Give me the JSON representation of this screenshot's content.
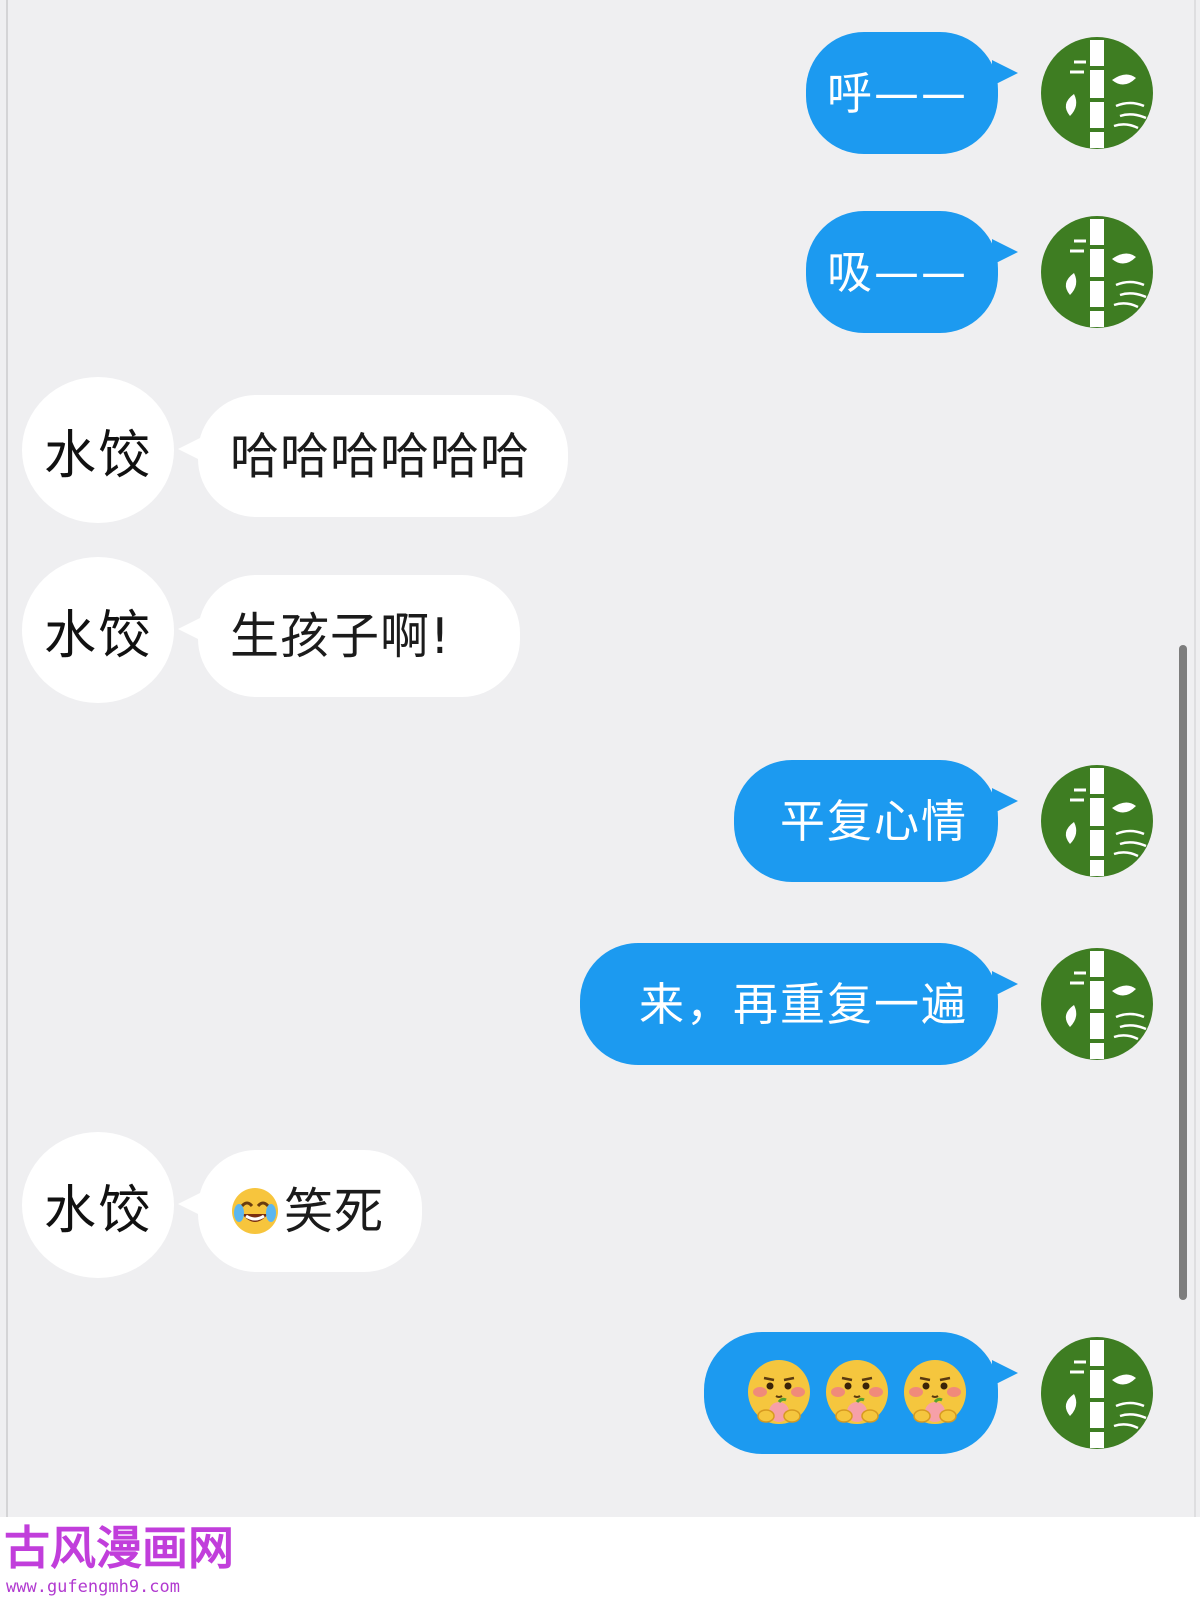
{
  "messages": [
    {
      "side": "sent",
      "text": "呼——"
    },
    {
      "side": "sent",
      "text": "吸——"
    },
    {
      "side": "received",
      "sender": "水饺",
      "text": "哈哈哈哈哈哈"
    },
    {
      "side": "received",
      "sender": "水饺",
      "text": "生孩子啊!"
    },
    {
      "side": "sent",
      "text": "平复心情"
    },
    {
      "side": "sent",
      "text": "来，再重复一遍"
    },
    {
      "side": "received",
      "sender": "水饺",
      "emoji": "tears-of-joy-icon",
      "text": "笑死"
    },
    {
      "side": "sent",
      "emoji": [
        "peach-holding-emoji",
        "peach-holding-emoji",
        "peach-holding-emoji"
      ]
    }
  ],
  "contact": {
    "name": "水饺"
  },
  "watermark": {
    "title": "古风漫画网",
    "url": "www.gufengmh9.com"
  },
  "colors": {
    "sent_bubble": "#1c9af0",
    "received_bubble": "#ffffff",
    "background": "#efeff1",
    "avatar_green": "#3e7d22",
    "watermark": "#c13edb"
  }
}
